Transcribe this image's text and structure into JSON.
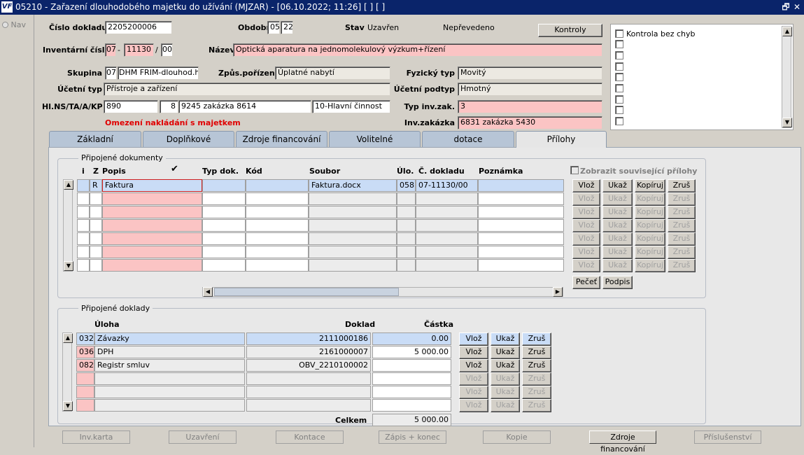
{
  "window": {
    "title": "05210 - Zařazení dlouhodobého majetku do užívání (MJZAR) - [06.10.2022; 11:26]  [ ]  [ ]",
    "logo": "VF",
    "restore_glyph": "🗗",
    "close_glyph": "✕"
  },
  "nav": {
    "label": "Nav"
  },
  "header": {
    "cislo_dokladu_label": "Číslo dokladu",
    "cislo_dokladu": "2205200006",
    "obdobi_label": "Období",
    "obdobi_mm": "05",
    "obdobi_yy": "22",
    "stav_label": "Stav",
    "stav_value": "Uzavřen",
    "neprevedeno": "Nepřevedeno",
    "kontroly_button": "Kontroly",
    "inv_cislo_label": "Inventární číslo",
    "inv_cislo_1": "07",
    "inv_cislo_sep": "-",
    "inv_cislo_2": "11130",
    "inv_cislo_slash": "/",
    "inv_cislo_3": "00",
    "nazev_label": "Název",
    "nazev": "Optická aparatura na jednomolekulový výzkum+řízení",
    "skupina_label": "Skupina",
    "skupina_code": "07",
    "skupina_name": "DHM FRIM-dlouhod.hmo",
    "zpusob_label": "Způs.pořízení",
    "zpusob": "Úplatné nabytí",
    "fyzicky_typ_label": "Fyzický typ",
    "fyzicky_typ": "Movitý",
    "ucetni_typ_label": "Účetní typ",
    "ucetni_typ": "Přístroje a zařízení",
    "ucetni_podtyp_label": "Účetní podtyp",
    "ucetni_podtyp": "Hmotný",
    "hlns_label": "Hl.NS/TA/A/KP",
    "hlns_ns": "890",
    "hlns_ta": "8",
    "hlns_a": "9245 zakázka 8614",
    "hlns_kp": "10-Hlavní činnost",
    "typ_inv_zak_label": "Typ inv.zak.",
    "typ_inv_zak": "3",
    "omezeni": "Omezení nakládání s majetkem",
    "inv_zakazka_label": "Inv.zakázka",
    "inv_zakazka": "6831 zakázka 5430"
  },
  "kontrola": {
    "label": "Kontrola bez chyb"
  },
  "tabs": [
    {
      "label": "Základní"
    },
    {
      "label": "Doplňkové"
    },
    {
      "label": "Zdroje financování"
    },
    {
      "label": "Volitelné"
    },
    {
      "label": "dotace"
    },
    {
      "label": "Přílohy"
    }
  ],
  "dokumenty": {
    "title": "Připojené dokumenty",
    "cols": {
      "i": "i",
      "z": "Z",
      "popis": "Popis",
      "check": "✔",
      "typ": "Typ dok.",
      "kod": "Kód",
      "soubor": "Soubor",
      "ulo": "Úlo.",
      "cdokladu": "Č. dokladu",
      "poznamka": "Poznámka"
    },
    "zobrazit": "Zobrazit související přílohy",
    "row1": {
      "i": "",
      "z": "R",
      "popis": "Faktura",
      "typ": "",
      "kod": "",
      "soubor": "Faktura.docx",
      "ulo": "058",
      "cdokladu": "07-11130/00",
      "poznamka": ""
    },
    "btn_vloz": "Vlož",
    "btn_ukaz": "Ukaž",
    "btn_kopiruj": "Kopíruj",
    "btn_zrus": "Zruš",
    "btn_pecet": "Pečeť",
    "btn_podpis": "Podpis"
  },
  "doklady": {
    "title": "Připojené doklady",
    "cols": {
      "uloha": "Úloha",
      "doklad": "Doklad",
      "castka": "Částka"
    },
    "rows": [
      {
        "code": "032",
        "name": "Závazky",
        "doklad": "2111000186",
        "castka": "0.00"
      },
      {
        "code": "036",
        "name": "DPH",
        "doklad": "2161000007",
        "castka": "5 000.00"
      },
      {
        "code": "082",
        "name": "Registr smluv",
        "doklad": "OBV_2210100002",
        "castka": ""
      }
    ],
    "celkem_label": "Celkem",
    "celkem": "5 000.00",
    "btn_vloz": "Vlož",
    "btn_ukaz": "Ukaž",
    "btn_zrus": "Zruš"
  },
  "bottom": [
    {
      "label": "Inv.karta"
    },
    {
      "label": "Uzavření"
    },
    {
      "label": "Kontace"
    },
    {
      "label": "Zápis + konec"
    },
    {
      "label": "Kopie"
    },
    {
      "label": "Zdroje financování"
    },
    {
      "label": "Příslušenství"
    }
  ]
}
